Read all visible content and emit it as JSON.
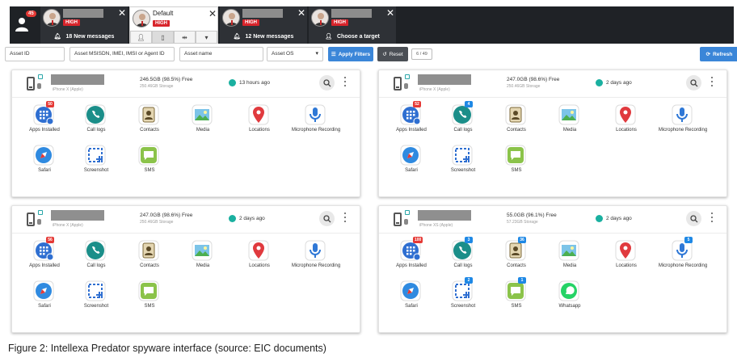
{
  "account_badge": "45",
  "tabs": [
    {
      "kind": "target",
      "high": "HIGH",
      "row2_text": "18 New messages",
      "row2_icon": "bell-icon"
    },
    {
      "kind": "default",
      "name": "Default",
      "high": "HIGH"
    },
    {
      "kind": "target",
      "high": "HIGH",
      "row2_text": "12 New messages",
      "row2_icon": "bell-icon"
    },
    {
      "kind": "target",
      "high": "HIGH",
      "row2_text": "Choose a target",
      "row2_icon": "person-icon"
    }
  ],
  "filters": {
    "asset_id": "Asset ID",
    "msisdn": "Asset MSISDN, IMEI, IMSI or Agent ID",
    "asset_name": "Asset name",
    "asset_os": "Asset OS",
    "apply": "Apply Filters",
    "reset": "Reset",
    "count": "6 / 49",
    "refresh": "Refresh"
  },
  "colors": {
    "dark_bar": "#1f2226",
    "tab_bg": "#2e3136",
    "accent_blue": "#3b86d8",
    "high_red": "#d8242b",
    "online_teal": "#1ab0a0",
    "badge_red": "#e53935",
    "badge_blue": "#1e88e5"
  },
  "devices": [
    {
      "model": "iPhone X (Apple)",
      "storage_free": "246.5GB (98.5%) Free",
      "storage_total": "250.46GB Storage",
      "last_seen": "13 hours ago",
      "apps": [
        {
          "label": "Apps Installed",
          "icon": "apps-installed-icon",
          "count": "50",
          "count_color": "red"
        },
        {
          "label": "Call logs",
          "icon": "phone-icon",
          "count": "",
          "count_color": ""
        },
        {
          "label": "Contacts",
          "icon": "contacts-icon",
          "count": "",
          "count_color": ""
        },
        {
          "label": "Media",
          "icon": "media-icon",
          "count": "",
          "count_color": ""
        },
        {
          "label": "Locations",
          "icon": "location-pin-icon",
          "count": "",
          "count_color": ""
        },
        {
          "label": "Microphone Recording",
          "icon": "microphone-icon",
          "count": "",
          "count_color": ""
        },
        {
          "label": "Safari",
          "icon": "safari-icon",
          "count": "",
          "count_color": ""
        },
        {
          "label": "Screenshot",
          "icon": "screenshot-icon",
          "count": "",
          "count_color": ""
        },
        {
          "label": "SMS",
          "icon": "sms-icon",
          "count": "",
          "count_color": ""
        }
      ]
    },
    {
      "model": "iPhone X (Apple)",
      "storage_free": "247.0GB (98.6%) Free",
      "storage_total": "250.46GB Storage",
      "last_seen": "2 days ago",
      "apps": [
        {
          "label": "Apps Installed",
          "icon": "apps-installed-icon",
          "count": "52",
          "count_color": "red"
        },
        {
          "label": "Call logs",
          "icon": "phone-icon",
          "count": "4",
          "count_color": "blue"
        },
        {
          "label": "Contacts",
          "icon": "contacts-icon",
          "count": "",
          "count_color": ""
        },
        {
          "label": "Media",
          "icon": "media-icon",
          "count": "",
          "count_color": ""
        },
        {
          "label": "Locations",
          "icon": "location-pin-icon",
          "count": "",
          "count_color": ""
        },
        {
          "label": "Microphone Recording",
          "icon": "microphone-icon",
          "count": "",
          "count_color": ""
        },
        {
          "label": "Safari",
          "icon": "safari-icon",
          "count": "",
          "count_color": ""
        },
        {
          "label": "Screenshot",
          "icon": "screenshot-icon",
          "count": "",
          "count_color": ""
        },
        {
          "label": "SMS",
          "icon": "sms-icon",
          "count": "",
          "count_color": ""
        }
      ]
    },
    {
      "model": "iPhone X (Apple)",
      "storage_free": "247.0GB (98.6%) Free",
      "storage_total": "250.46GB Storage",
      "last_seen": "2 days ago",
      "apps": [
        {
          "label": "Apps Installed",
          "icon": "apps-installed-icon",
          "count": "56",
          "count_color": "red"
        },
        {
          "label": "Call logs",
          "icon": "phone-icon",
          "count": "",
          "count_color": ""
        },
        {
          "label": "Contacts",
          "icon": "contacts-icon",
          "count": "",
          "count_color": ""
        },
        {
          "label": "Media",
          "icon": "media-icon",
          "count": "",
          "count_color": ""
        },
        {
          "label": "Locations",
          "icon": "location-pin-icon",
          "count": "",
          "count_color": ""
        },
        {
          "label": "Microphone Recording",
          "icon": "microphone-icon",
          "count": "",
          "count_color": ""
        },
        {
          "label": "Safari",
          "icon": "safari-icon",
          "count": "",
          "count_color": ""
        },
        {
          "label": "Screenshot",
          "icon": "screenshot-icon",
          "count": "",
          "count_color": ""
        },
        {
          "label": "SMS",
          "icon": "sms-icon",
          "count": "",
          "count_color": ""
        }
      ]
    },
    {
      "model": "iPhone XS (Apple)",
      "storage_free": "55.0GB (96.1%) Free",
      "storage_total": "57.23GB Storage",
      "last_seen": "2 days ago",
      "apps": [
        {
          "label": "Apps Installed",
          "icon": "apps-installed-icon",
          "count": "100",
          "count_color": "red"
        },
        {
          "label": "Call logs",
          "icon": "phone-icon",
          "count": "3",
          "count_color": "blue"
        },
        {
          "label": "Contacts",
          "icon": "contacts-icon",
          "count": "36",
          "count_color": "blue"
        },
        {
          "label": "Media",
          "icon": "media-icon",
          "count": "",
          "count_color": ""
        },
        {
          "label": "Locations",
          "icon": "location-pin-icon",
          "count": "",
          "count_color": ""
        },
        {
          "label": "Microphone Recording",
          "icon": "microphone-icon",
          "count": "5",
          "count_color": "blue"
        },
        {
          "label": "Safari",
          "icon": "safari-icon",
          "count": "",
          "count_color": ""
        },
        {
          "label": "Screenshot",
          "icon": "screenshot-icon",
          "count": "2",
          "count_color": "blue"
        },
        {
          "label": "SMS",
          "icon": "sms-icon",
          "count": "1",
          "count_color": "blue"
        },
        {
          "label": "Whatsapp",
          "icon": "whatsapp-icon",
          "count": "",
          "count_color": ""
        }
      ]
    }
  ],
  "caption": "Figure 2: Intellexa Predator spyware interface (source: EIC documents)"
}
